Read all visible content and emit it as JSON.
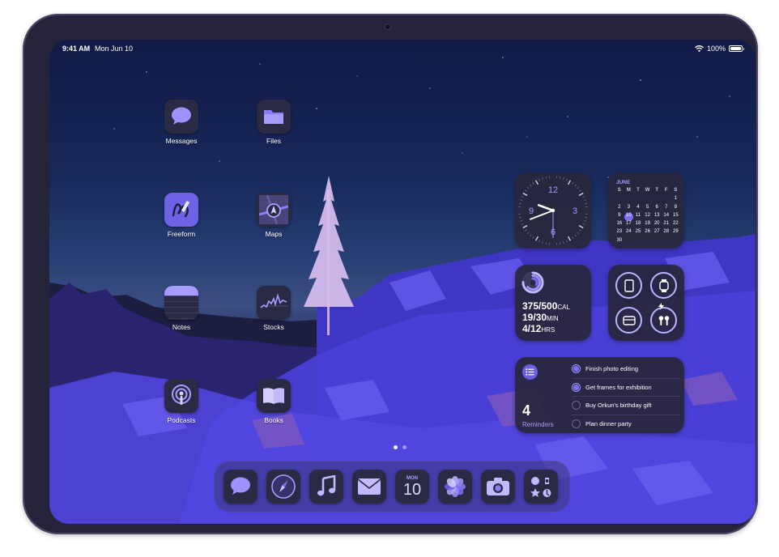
{
  "status_bar": {
    "time": "9:41 AM",
    "date": "Mon Jun 10",
    "battery": "100%",
    "battery_fraction": 1.0
  },
  "apps": [
    {
      "label": "Messages",
      "icon": "message-bubble-icon"
    },
    {
      "label": "Files",
      "icon": "folder-icon"
    },
    {
      "label": "Freeform",
      "icon": "freeform-scribble-icon"
    },
    {
      "label": "Maps",
      "icon": "map-icon"
    },
    {
      "label": "Notes",
      "icon": "notes-icon"
    },
    {
      "label": "Stocks",
      "icon": "stocks-chart-icon"
    },
    {
      "label": "Podcasts",
      "icon": "podcast-icon"
    },
    {
      "label": "Books",
      "icon": "book-icon"
    }
  ],
  "clock_widget": {
    "numerals": [
      "12",
      "3",
      "6",
      "9"
    ],
    "hour": 9,
    "minute": 41,
    "second": 30
  },
  "calendar_widget": {
    "month": "JUNE",
    "day_headers": [
      "S",
      "M",
      "T",
      "W",
      "T",
      "F",
      "S"
    ],
    "today": "10",
    "weeks": [
      [
        "",
        "",
        "",
        "",
        "",
        "",
        "1"
      ],
      [
        "2",
        "3",
        "4",
        "5",
        "6",
        "7",
        "8"
      ],
      [
        "9",
        "10",
        "11",
        "12",
        "13",
        "14",
        "15"
      ],
      [
        "16",
        "17",
        "18",
        "19",
        "20",
        "21",
        "22"
      ],
      [
        "23",
        "24",
        "25",
        "26",
        "27",
        "28",
        "29"
      ],
      [
        "30",
        "",
        "",
        "",
        "",
        "",
        ""
      ]
    ]
  },
  "fitness_widget": {
    "move": {
      "value": "375/500",
      "unit": "CAL",
      "fraction": 0.75
    },
    "exercise": {
      "value": "19/30",
      "unit": "MIN",
      "fraction": 0.63
    },
    "stand": {
      "value": "4/12",
      "unit": "HRS",
      "fraction": 0.33
    }
  },
  "batteries_widget": {
    "devices": [
      "ipad-icon",
      "watch-icon",
      "pencil-case-icon",
      "airpods-icon"
    ]
  },
  "reminders_widget": {
    "count": "4",
    "label": "Reminders",
    "items": [
      {
        "text": "Finish photo editing",
        "done": true
      },
      {
        "text": "Get frames for exhibition",
        "done": true
      },
      {
        "text": "Buy Orkun's birthday gift",
        "done": false
      },
      {
        "text": "Plan dinner party",
        "done": false
      }
    ]
  },
  "page_dots": {
    "count": 2,
    "active": 0
  },
  "dock": {
    "apps": [
      "messages-icon",
      "safari-compass-icon",
      "music-note-icon",
      "mail-envelope-icon",
      "calendar-icon",
      "photos-flower-icon",
      "camera-icon",
      "utilities-folder-icon"
    ],
    "calendar_day": "MON",
    "calendar_date": "10"
  },
  "colors": {
    "accent": "#7c6cf2",
    "accent_light": "#a99cff",
    "icon_bg": "#2b2a44",
    "widget_bg": "#28263e"
  }
}
